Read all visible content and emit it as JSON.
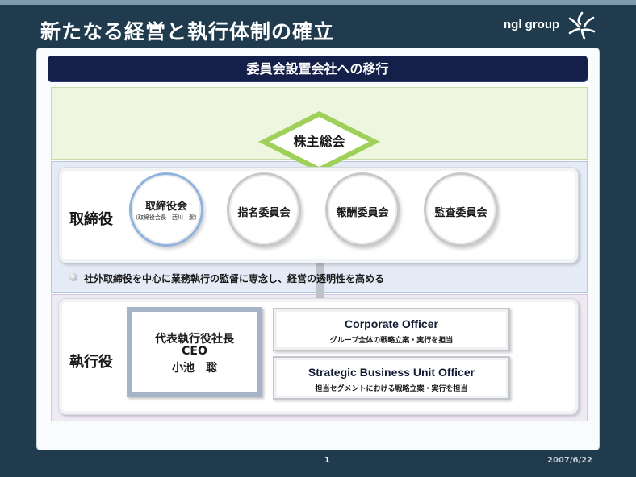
{
  "slide": {
    "title": "新たなる経営と執行体制の確立",
    "brand": "ngl group",
    "banner": "委員会設置会社への移行",
    "page_number": "1",
    "date": "2007/6/22"
  },
  "shareholders": {
    "label": "株主総会"
  },
  "board": {
    "row_label": "取締役",
    "committees": [
      {
        "title": "取締役会",
        "subtitle": "（取締役会長　西川　潔）"
      },
      {
        "title": "指名委員会"
      },
      {
        "title": "報酬委員会"
      },
      {
        "title": "監査委員会"
      }
    ],
    "note": "社外取締役を中心に業務執行の監督に専念し、経営の透明性を高める"
  },
  "executive": {
    "row_label": "執行役",
    "ceo": {
      "line1": "代表執行役社長",
      "line2": "CEO",
      "line3": "小池　聡"
    },
    "officers": [
      {
        "title": "Corporate Officer",
        "desc": "グループ全体の戦略立案・実行を担当"
      },
      {
        "title": "Strategic Business Unit Officer",
        "desc": "担当セグメントにおける戦略立案・実行を担当"
      }
    ]
  },
  "colors": {
    "background": "#1f3b4d",
    "banner": "#15204a",
    "shareholder_section": "#eef6e0",
    "board_section": "#e4ebf6",
    "executive_section": "#eee9f2",
    "diamond_border": "#8cc63f"
  },
  "icons": {
    "brand_logo": "ngl-star-logo-icon",
    "note_bullet": "bullet-icon"
  }
}
